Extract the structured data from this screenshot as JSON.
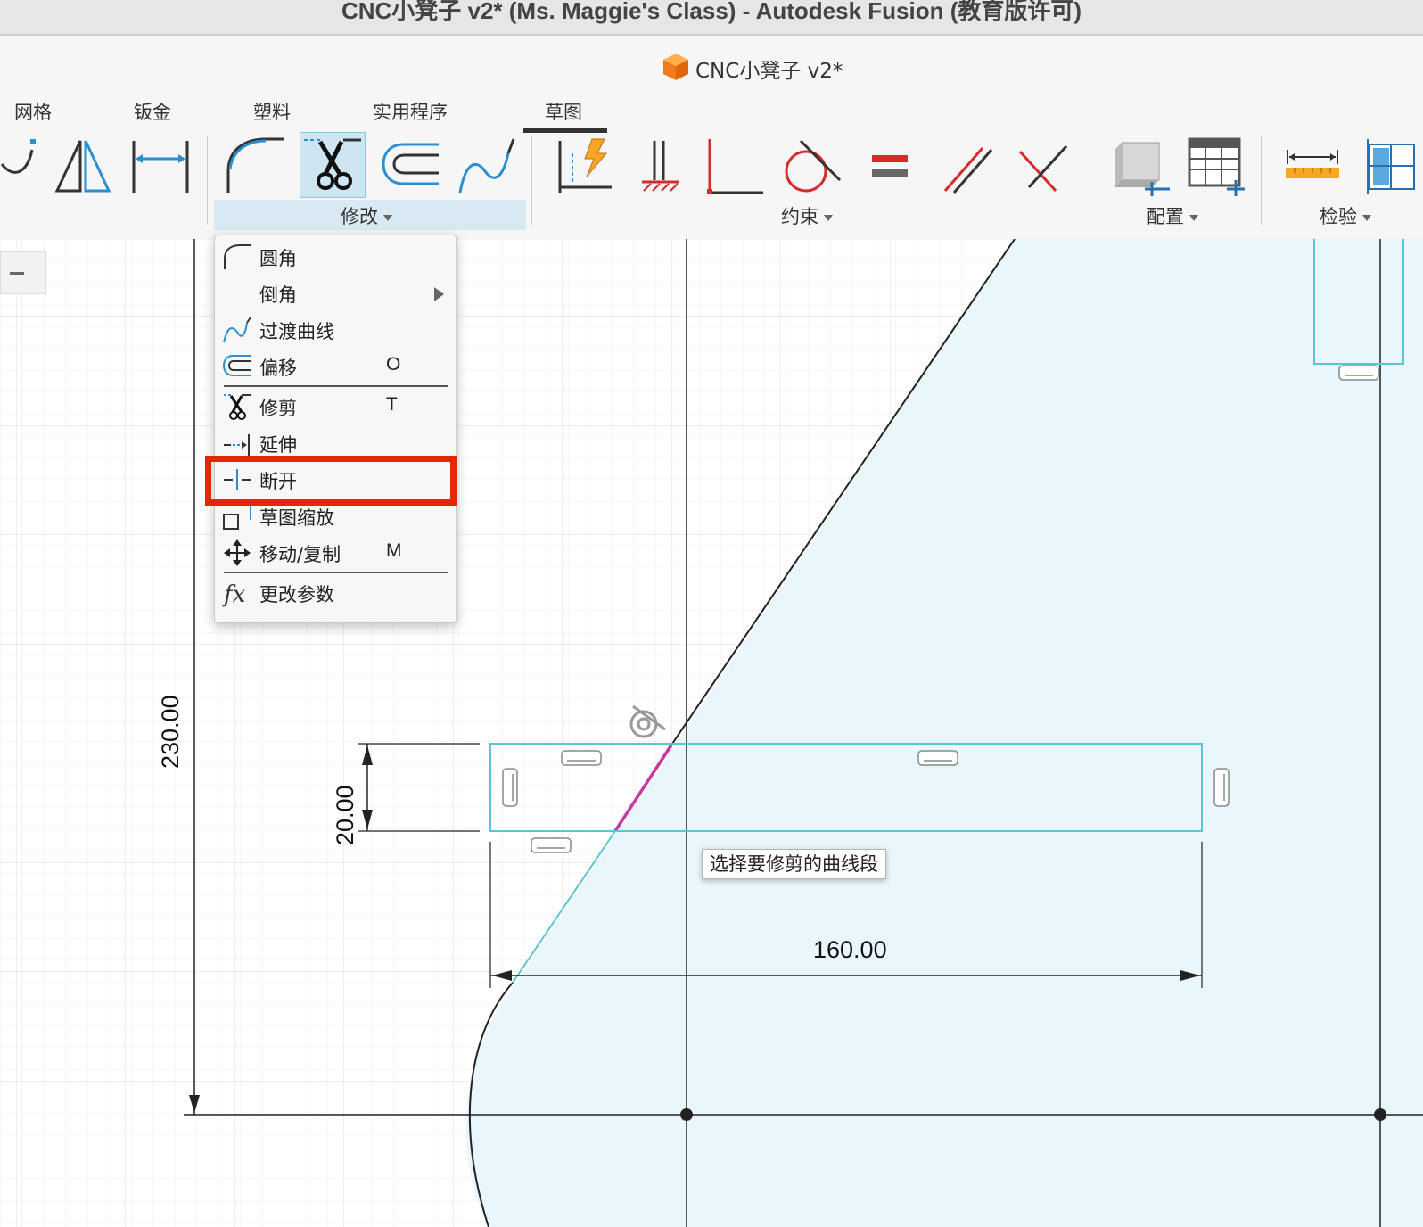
{
  "window": {
    "title": "CNC小凳子 v2* (Ms. Maggie's Class) - Autodesk Fusion (教育版许可)"
  },
  "document_tab": {
    "name": "CNC小凳子 v2*",
    "icon": "orange-cube-icon"
  },
  "ribbon": {
    "tabs": [
      {
        "label": "网格"
      },
      {
        "label": "钣金"
      },
      {
        "label": "塑料"
      },
      {
        "label": "实用程序"
      },
      {
        "label": "草图",
        "active": true
      }
    ],
    "groups": {
      "modify": "修改",
      "constraints": "约束",
      "configure": "配置",
      "inspect": "检验"
    },
    "tools": [
      "spline-icon",
      "mirror-icon",
      "dimension-line-icon",
      "fillet-icon",
      "trim-scissors-icon",
      "offset-icon",
      "blend-curve-icon",
      "sketch-constraint-auto-icon",
      "fix-icon",
      "perpendicular-icon",
      "tangent-circle-icon",
      "equal-icon",
      "parallel-icon",
      "perpendicular-cross-icon",
      "configure-cube-icon",
      "configure-table-icon",
      "measure-icon",
      "inspect-panel-icon"
    ]
  },
  "modify_menu": {
    "items": [
      {
        "label": "圆角",
        "shortcut": "",
        "icon": "fillet-icon"
      },
      {
        "label": "倒角",
        "shortcut": "",
        "icon": "",
        "submenu": true
      },
      {
        "label": "过渡曲线",
        "shortcut": "",
        "icon": "blend-curve-icon"
      },
      {
        "label": "偏移",
        "shortcut": "O",
        "icon": "offset-icon"
      },
      {
        "label": "修剪",
        "shortcut": "T",
        "icon": "trim-icon"
      },
      {
        "label": "延伸",
        "shortcut": "",
        "icon": "extend-icon"
      },
      {
        "label": "断开",
        "shortcut": "",
        "icon": "break-icon",
        "highlighted": true
      },
      {
        "label": "草图缩放",
        "shortcut": "",
        "icon": "sketch-scale-icon"
      },
      {
        "label": "移动/复制",
        "shortcut": "M",
        "icon": "move-copy-icon"
      },
      {
        "label": "更改参数",
        "shortcut": "",
        "icon": "fx-icon"
      }
    ]
  },
  "canvas": {
    "tooltip": "选择要修剪的曲线段",
    "dimensions": {
      "height_total": "230.00",
      "rect_height": "20.00",
      "rect_width": "160.00"
    }
  },
  "colors": {
    "highlight_red": "#e12800",
    "sketch_blue": "#5bc4d6",
    "fill_blue": "#e9f6fb",
    "selected_magenta": "#c43aa0"
  }
}
